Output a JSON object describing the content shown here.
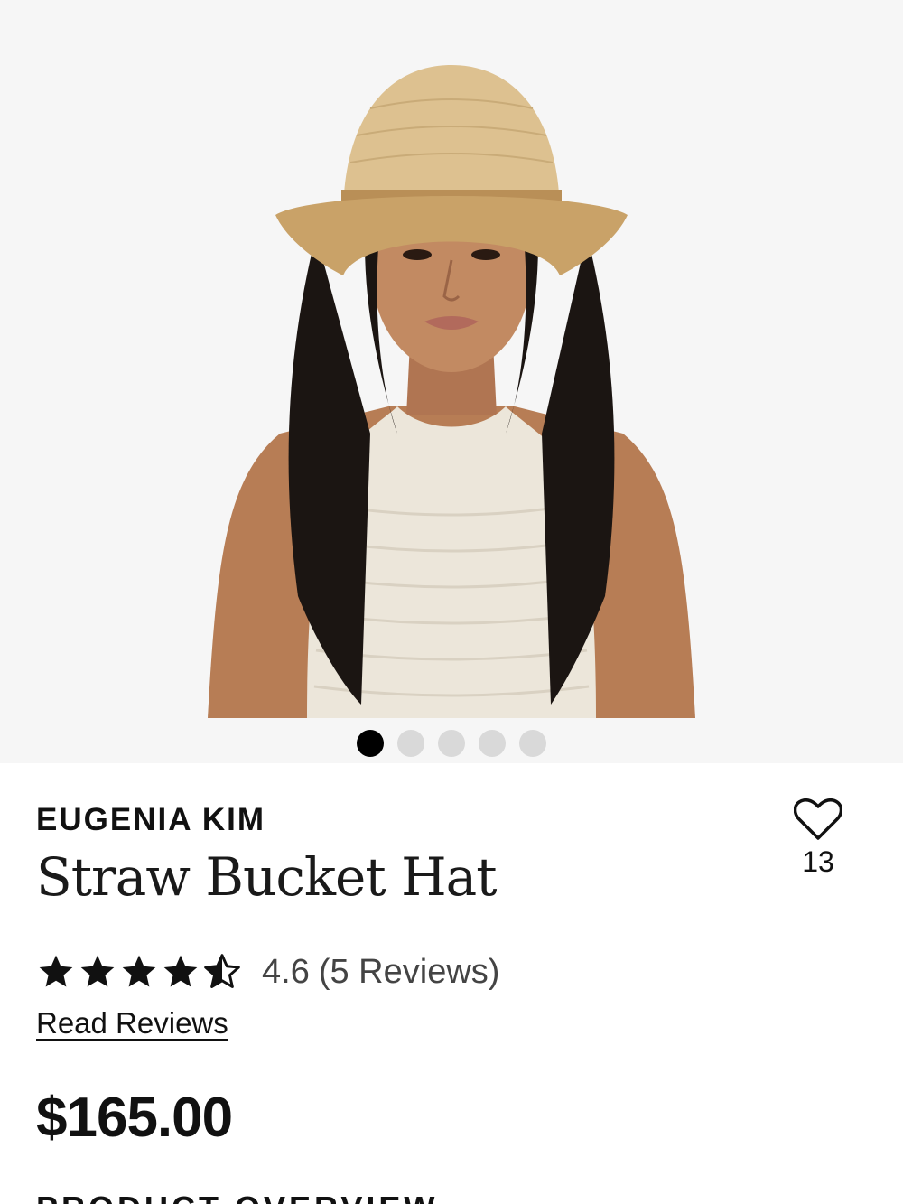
{
  "gallery": {
    "image_alt": "Woman wearing a straw bucket hat",
    "slide_count": 5,
    "active_slide": 1
  },
  "product": {
    "brand": "EUGENIA KIM",
    "name": "Straw Bucket Hat",
    "favorite_count": "13",
    "rating": {
      "value": "4.6",
      "reviews_label": "(5 Reviews)",
      "stars_filled": 4.6
    },
    "read_reviews_label": "Read Reviews",
    "price": "$165.00"
  },
  "sections": {
    "overview_heading": "PRODUCT OVERVIEW"
  },
  "colors": {
    "gallery_bg": "#f6f6f6",
    "dot_active": "#000000",
    "dot_inactive": "#d9d9d9",
    "text_primary": "#111111",
    "text_secondary": "#444444"
  },
  "icons": {
    "favorite": "heart-outline-icon",
    "star_full": "star-filled-icon",
    "star_half": "star-half-icon"
  }
}
